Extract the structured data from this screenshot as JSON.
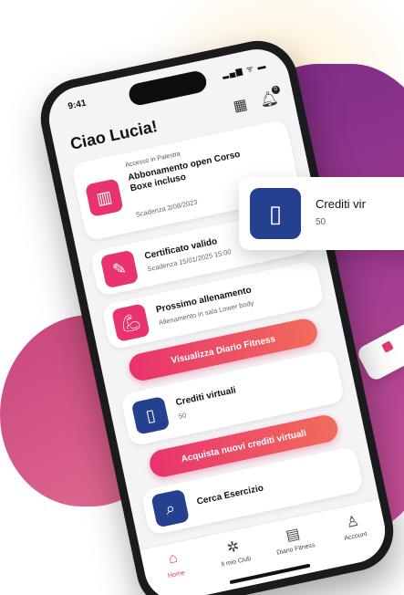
{
  "status_bar": {
    "time": "9:41",
    "system": "▂▄▆ ᯤ ▬"
  },
  "header": {
    "greeting": "Ciao Lucia!"
  },
  "icons": {
    "qr": "qr-code-icon",
    "bell": "bell-icon",
    "notif_count": "0"
  },
  "access_card": {
    "label": "Accesso in Palestra",
    "title": "Abbonamento open Corso Boxe incluso",
    "expiry": "Scadenza 2/08/2023",
    "icon": "building-icon"
  },
  "certificate_card": {
    "title": "Certificato valido",
    "expiry": "Scadenza 15/01/2025 15:00",
    "icon": "document-icon"
  },
  "training_card": {
    "title": "Prossimo allenamento",
    "detail": "Allenamento in sala Lower body",
    "icon": "muscle-icon"
  },
  "buttons": {
    "diary": "Visualizza Diario Fitness",
    "buy_credits": "Acquista nuovi crediti virtuali"
  },
  "credits_card": {
    "title": "Crediti virtuali",
    "value": "50",
    "icon": "phone-dumbbell-icon"
  },
  "search_card": {
    "title": "Cerca Esercizio",
    "icon": "search-icon"
  },
  "tabbar": [
    {
      "label": "Home",
      "icon": "home-icon",
      "active": true
    },
    {
      "label": "Il mio Club",
      "icon": "club-icon",
      "active": false
    },
    {
      "label": "Diario Fitness",
      "icon": "diary-icon",
      "active": false
    },
    {
      "label": "Account",
      "icon": "user-icon",
      "active": false
    }
  ],
  "floating_card": {
    "title": "Crediti vir",
    "value": "50"
  },
  "colors": {
    "accent": "#e8336e",
    "blue": "#25408f",
    "blob": "#9c3a8f"
  }
}
